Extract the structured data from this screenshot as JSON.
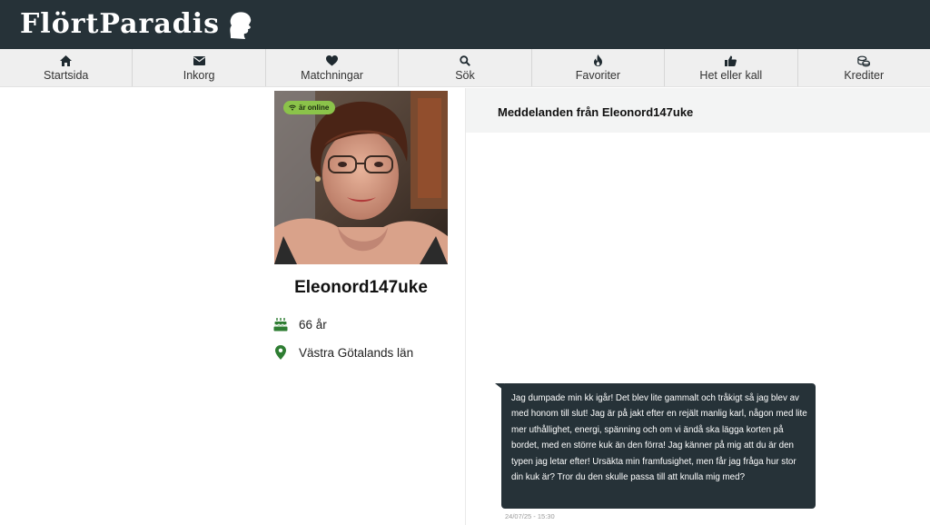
{
  "brand": {
    "name": "FlörtParadis"
  },
  "nav": {
    "items": [
      {
        "label": "Startsida",
        "icon": "home-icon"
      },
      {
        "label": "Inkorg",
        "icon": "envelope-icon"
      },
      {
        "label": "Matchningar",
        "icon": "heart-icon"
      },
      {
        "label": "Sök",
        "icon": "search-icon"
      },
      {
        "label": "Favoriter",
        "icon": "flame-icon"
      },
      {
        "label": "Het eller kall",
        "icon": "thumbs-up-icon"
      },
      {
        "label": "Krediter",
        "icon": "coins-icon"
      }
    ]
  },
  "profile": {
    "online_badge": "är online",
    "username": "Eleonord147uke",
    "age": "66 år",
    "location": "Västra Götalands län"
  },
  "conversation": {
    "title": "Meddelanden från Eleonord147uke",
    "messages": [
      {
        "text": "Jag dumpade min kk igår! Det blev lite gammalt och tråkigt så jag blev av med honom till slut! Jag är på jakt efter en rejält manlig karl, någon med lite mer uthållighet, energi, spänning och om vi ändå ska lägga korten på bordet, med en större kuk än den förra! Jag känner på mig att du är den typen jag letar efter! Ursäkta min framfusighet, men får jag fråga hur stor din kuk är? Tror du den skulle passa till att knulla mig med?",
        "timestamp": "24/07/25 - 15:30"
      }
    ]
  },
  "colors": {
    "header_bg": "#263238",
    "nav_bg": "#efefef",
    "online_green": "#8bc34a",
    "icon_green": "#2e7d32"
  }
}
